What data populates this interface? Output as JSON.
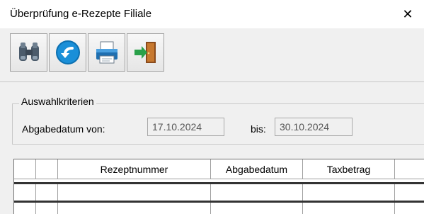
{
  "window": {
    "title": "Überprüfung e-Rezepte Filiale",
    "close_glyph": "✕"
  },
  "toolbar": {
    "buttons": [
      {
        "icon": "binoculars-icon",
        "tooltip": ""
      },
      {
        "icon": "back-arrow-icon",
        "tooltip": ""
      },
      {
        "icon": "printer-icon",
        "tooltip": ""
      },
      {
        "icon": "exit-door-icon",
        "tooltip": ""
      }
    ]
  },
  "criteria": {
    "legend": "Auswahlkriterien",
    "date_label": "Abgabedatum  von:",
    "from_value": "17.10.2024",
    "to_label": "bis:",
    "to_value": "30.10.2024"
  },
  "grid": {
    "columns": [
      "",
      "",
      "Rezeptnummer",
      "Abgabedatum",
      "Taxbetrag",
      ""
    ],
    "rows": [
      [
        "",
        "",
        "",
        "",
        "",
        ""
      ],
      [
        "",
        "",
        "",
        "",
        "",
        ""
      ]
    ]
  },
  "colors": {
    "background": "#f0f0f0",
    "border": "#a0a0a0",
    "row_separator": "#333333"
  }
}
